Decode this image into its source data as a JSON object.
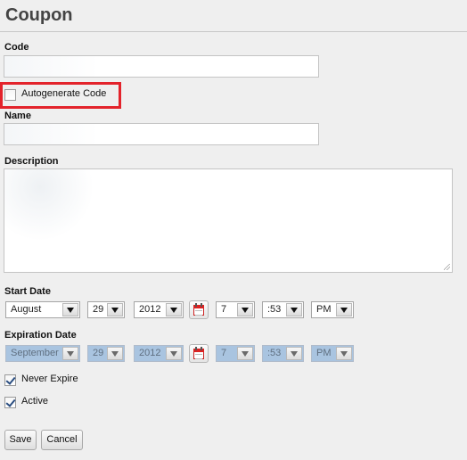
{
  "page": {
    "title": "Coupon"
  },
  "code": {
    "label": "Code",
    "value": ""
  },
  "autogenerate": {
    "label": "Autogenerate Code",
    "checked": false
  },
  "name": {
    "label": "Name",
    "value": ""
  },
  "description": {
    "label": "Description",
    "value": ""
  },
  "start_date": {
    "label": "Start Date",
    "month": "August",
    "day": "29",
    "year": "2012",
    "hour": "7",
    "minute": ":53",
    "ampm": "PM"
  },
  "expiration_date": {
    "label": "Expiration Date",
    "month": "September",
    "day": "29",
    "year": "2012",
    "hour": "7",
    "minute": ":53",
    "ampm": "PM"
  },
  "never_expire": {
    "label": "Never Expire",
    "checked": true
  },
  "active": {
    "label": "Active",
    "checked": true
  },
  "buttons": {
    "save": "Save",
    "cancel": "Cancel"
  },
  "colors": {
    "highlight": "#e3232b",
    "disabled_select": "#a9c4e0"
  },
  "icons": {
    "calendar": "calendar-icon",
    "dropdown": "chevron-down-icon"
  }
}
